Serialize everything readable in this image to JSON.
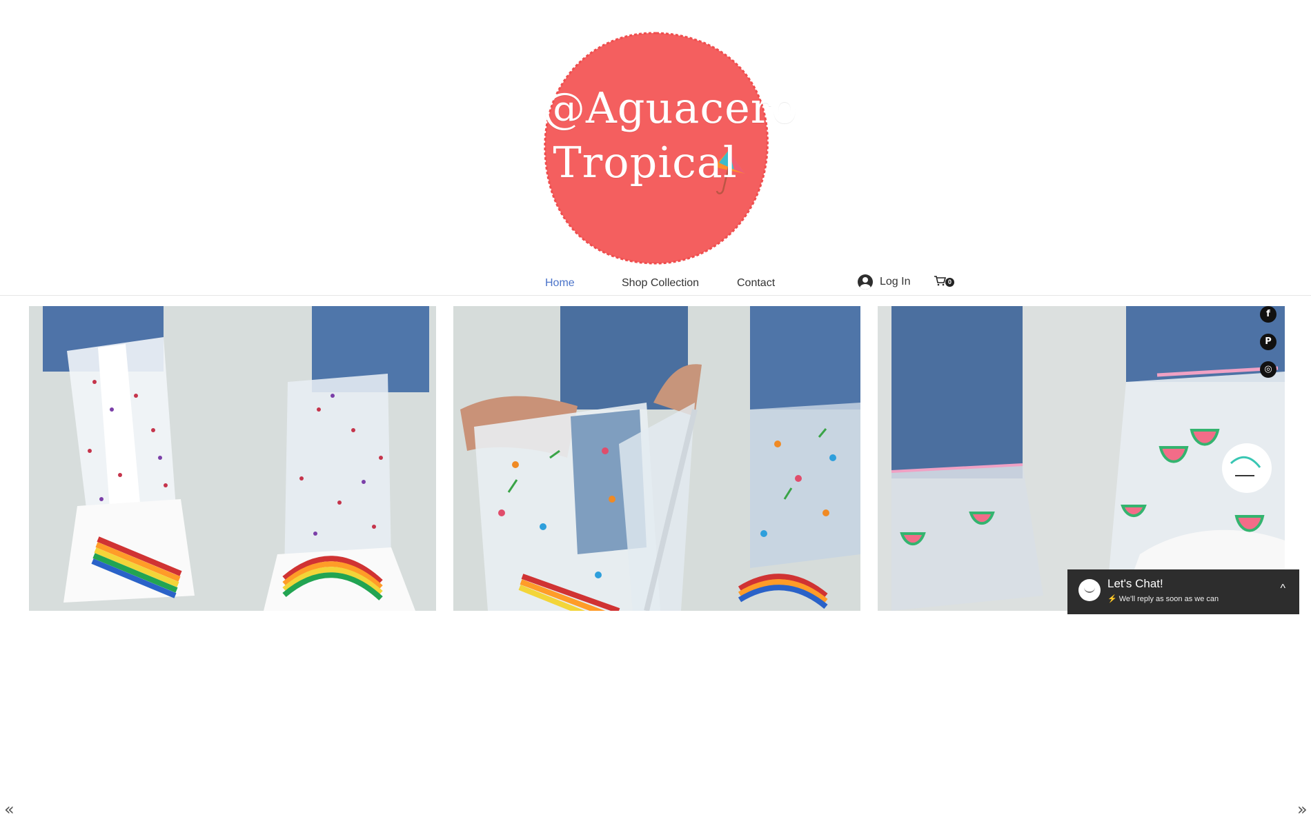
{
  "header": {
    "logo": {
      "line1": "@Aguacero",
      "line2": "Tropical",
      "circle_color": "#f45f5f"
    },
    "nav": [
      {
        "label": "Home",
        "active": true
      },
      {
        "label": "Shop Collection",
        "active": false
      },
      {
        "label": "Contact",
        "active": false
      }
    ],
    "login_label": "Log In",
    "cart_count": "0"
  },
  "gallery": {
    "prev_arrow": "«",
    "next_arrow": "»",
    "slides": [
      {
        "description_icon": "polka-dot-rain-boot-cover"
      },
      {
        "description_icon": "floral-rain-boot-cover"
      },
      {
        "description_icon": "watermelon-rain-boot-cover"
      }
    ]
  },
  "social": [
    {
      "name": "facebook-icon",
      "glyph": "f"
    },
    {
      "name": "pinterest-icon",
      "glyph": "P"
    },
    {
      "name": "instagram-icon",
      "glyph": "◎"
    }
  ],
  "chat": {
    "title": "Let's Chat!",
    "subtitle": "⚡ We'll reply as soon as we can",
    "chevron": "^"
  }
}
